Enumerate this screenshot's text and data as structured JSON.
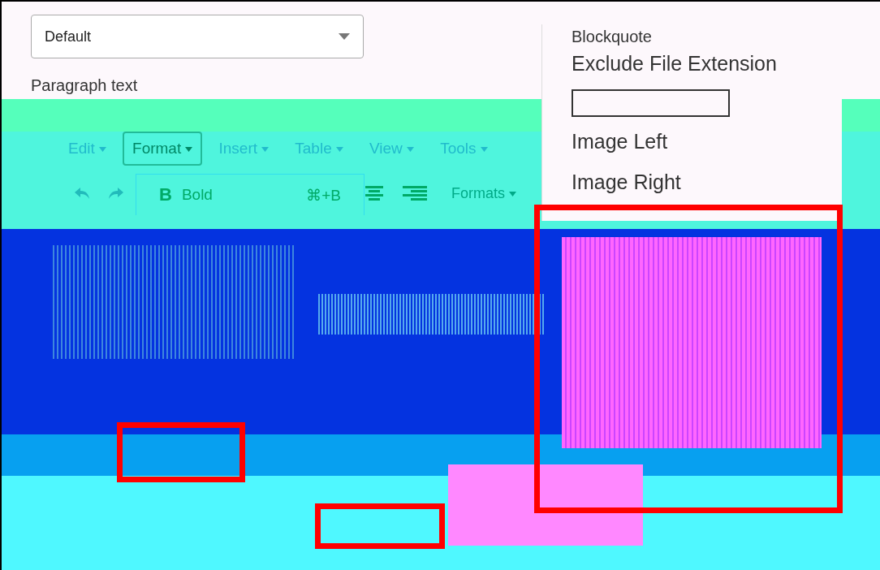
{
  "style_select": {
    "value": "Default"
  },
  "block_label": "Paragraph text",
  "menubar": [
    {
      "label": "Edit",
      "selected": false
    },
    {
      "label": "Format",
      "selected": true
    },
    {
      "label": "Insert",
      "selected": false
    },
    {
      "label": "Table",
      "selected": false
    },
    {
      "label": "View",
      "selected": false
    },
    {
      "label": "Tools",
      "selected": false
    }
  ],
  "toolbar": {
    "formats_label": "Formats"
  },
  "format_menu": [
    {
      "icon": "B",
      "label": "Bold",
      "shortcut": "⌘+B"
    }
  ],
  "styles_menu": {
    "items": [
      {
        "label": "Blockquote",
        "kind": "item"
      },
      {
        "label": "Exclude File Extension",
        "kind": "item"
      },
      {
        "kind": "field"
      },
      {
        "label": "Image Left",
        "kind": "item"
      },
      {
        "label": "Image Right",
        "kind": "item"
      }
    ]
  },
  "highlights": [
    {
      "kind": "small"
    },
    {
      "kind": "small"
    },
    {
      "kind": "large"
    }
  ]
}
